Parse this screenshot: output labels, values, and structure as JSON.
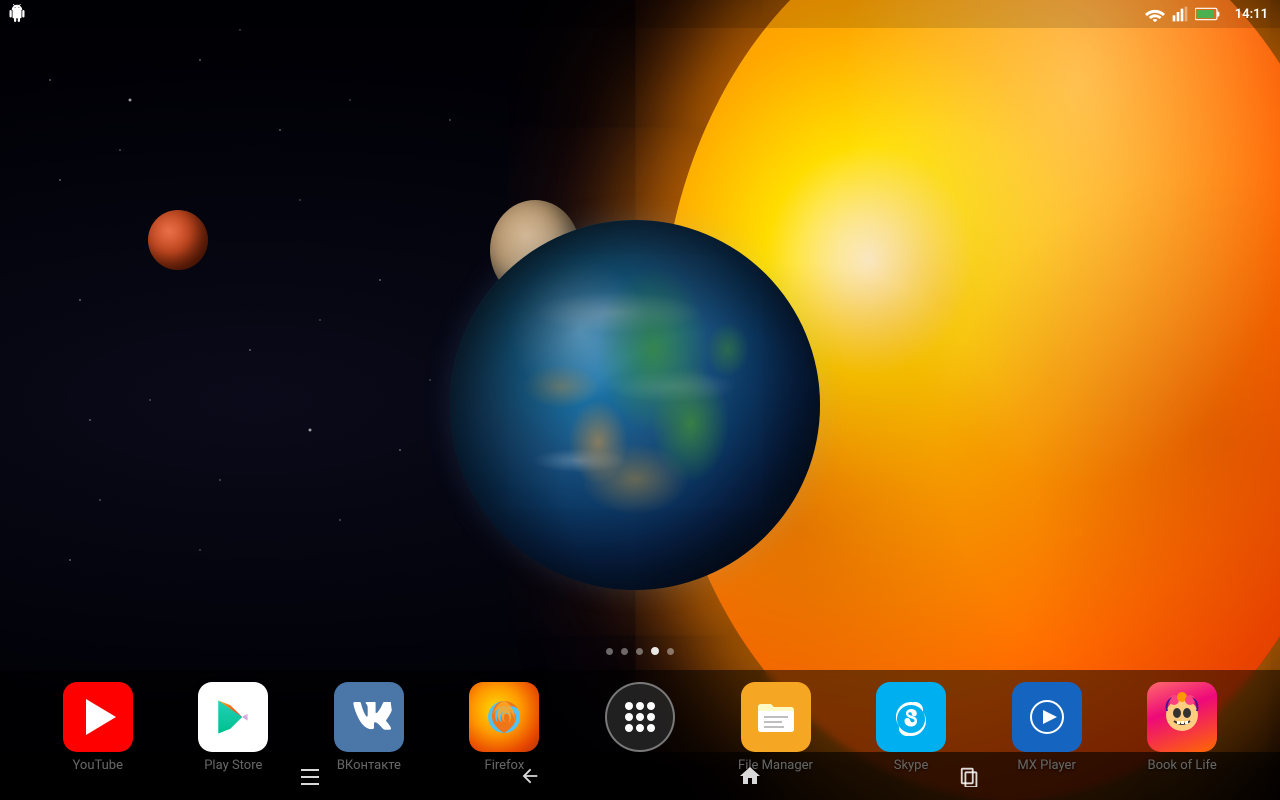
{
  "statusbar": {
    "time": "14:11",
    "wifi": "wifi",
    "signal": "signal",
    "battery": "battery"
  },
  "pagedots": [
    {
      "active": false
    },
    {
      "active": false
    },
    {
      "active": false
    },
    {
      "active": true
    },
    {
      "active": false
    }
  ],
  "apps": [
    {
      "name": "youtube-app",
      "label": "YouTube",
      "bg": "youtube"
    },
    {
      "name": "playstore-app",
      "label": "Play Store",
      "bg": "playstore"
    },
    {
      "name": "vk-app",
      "label": "ВКонтакте",
      "bg": "vk"
    },
    {
      "name": "firefox-app",
      "label": "Firefox",
      "bg": "firefox"
    },
    {
      "name": "appdrawer-app",
      "label": "",
      "bg": "appdrawer"
    },
    {
      "name": "filemanager-app",
      "label": "File Manager",
      "bg": "filemanager"
    },
    {
      "name": "skype-app",
      "label": "Skype",
      "bg": "skype"
    },
    {
      "name": "mxplayer-app",
      "label": "MX Player",
      "bg": "mxplayer"
    },
    {
      "name": "bookoflife-app",
      "label": "Book of Life",
      "bg": "bookoflife"
    }
  ],
  "navbar": {
    "menu_label": "≡",
    "back_label": "←",
    "home_label": "⌂",
    "recents_label": "▭"
  }
}
